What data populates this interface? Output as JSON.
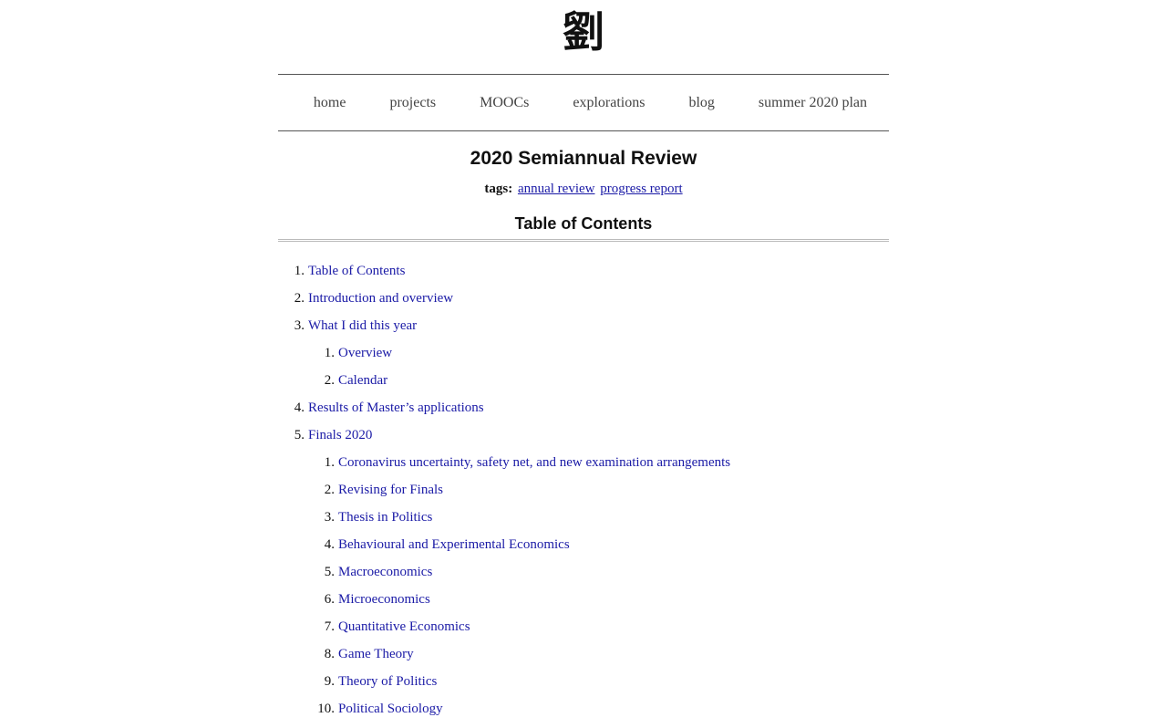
{
  "logo": "劉",
  "nav": {
    "items": [
      "home",
      "projects",
      "MOOCs",
      "explorations",
      "blog",
      "summer 2020 plan"
    ]
  },
  "page": {
    "title": "2020 Semiannual Review",
    "tags_label": "tags:",
    "tags": [
      "annual review",
      "progress report"
    ]
  },
  "toc": {
    "title": "Table of Contents",
    "items": [
      {
        "num": "1.",
        "label": "Table of Contents"
      },
      {
        "num": "2.",
        "label": "Introduction and overview"
      },
      {
        "num": "3.",
        "label": "What I did this year",
        "children": [
          {
            "num": "1.",
            "label": "Overview"
          },
          {
            "num": "2.",
            "label": "Calendar"
          }
        ]
      },
      {
        "num": "4.",
        "label": "Results of Master’s applications"
      },
      {
        "num": "5.",
        "label": "Finals 2020",
        "children": [
          {
            "num": "1.",
            "label": "Coronavirus uncertainty, safety net, and new examination arrangements"
          },
          {
            "num": "2.",
            "label": "Revising for Finals"
          },
          {
            "num": "3.",
            "label": "Thesis in Politics"
          },
          {
            "num": "4.",
            "label": "Behavioural and Experimental Economics"
          },
          {
            "num": "5.",
            "label": "Macroeconomics"
          },
          {
            "num": "6.",
            "label": "Microeconomics"
          },
          {
            "num": "7.",
            "label": "Quantitative Economics"
          },
          {
            "num": "8.",
            "label": "Game Theory"
          },
          {
            "num": "9.",
            "label": "Theory of Politics"
          },
          {
            "num": "10.",
            "label": "Political Sociology"
          }
        ]
      }
    ]
  }
}
